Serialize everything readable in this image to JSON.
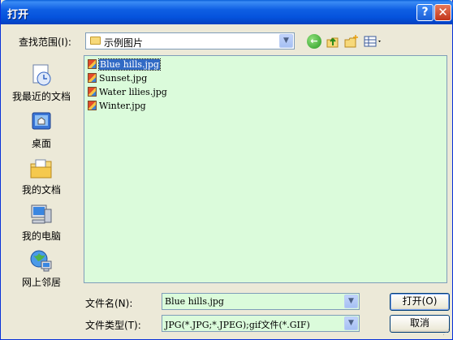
{
  "window": {
    "title": "打开"
  },
  "titlebar": {
    "help_glyph": "?",
    "close_glyph": "✕"
  },
  "lookin": {
    "label": "查找范围(I):",
    "value": "示例图片",
    "icons": [
      "back-icon",
      "up-folder-icon",
      "new-folder-icon",
      "views-menu-icon"
    ]
  },
  "places": [
    {
      "label": "我最近的文档",
      "icon": "recent-documents-icon"
    },
    {
      "label": "桌面",
      "icon": "desktop-icon"
    },
    {
      "label": "我的文档",
      "icon": "my-documents-icon"
    },
    {
      "label": "我的电脑",
      "icon": "my-computer-icon"
    },
    {
      "label": "网上邻居",
      "icon": "network-places-icon"
    }
  ],
  "files": [
    {
      "name": "Blue hills.jpg",
      "selected": true
    },
    {
      "name": "Sunset.jpg",
      "selected": false
    },
    {
      "name": "Water lilies.jpg",
      "selected": false
    },
    {
      "name": "Winter.jpg",
      "selected": false
    }
  ],
  "filename": {
    "label": "文件名(N):",
    "value": "Blue hills.jpg"
  },
  "filetype": {
    "label": "文件类型(T):",
    "value": "JPG(*.JPG;*.JPEG);gif文件(*.GIF)"
  },
  "buttons": {
    "open": "打开(O)",
    "cancel": "取消"
  },
  "colors": {
    "list_background": "#dbfbdb",
    "titlebar": "#0553dd",
    "selection": "#316ac5"
  }
}
